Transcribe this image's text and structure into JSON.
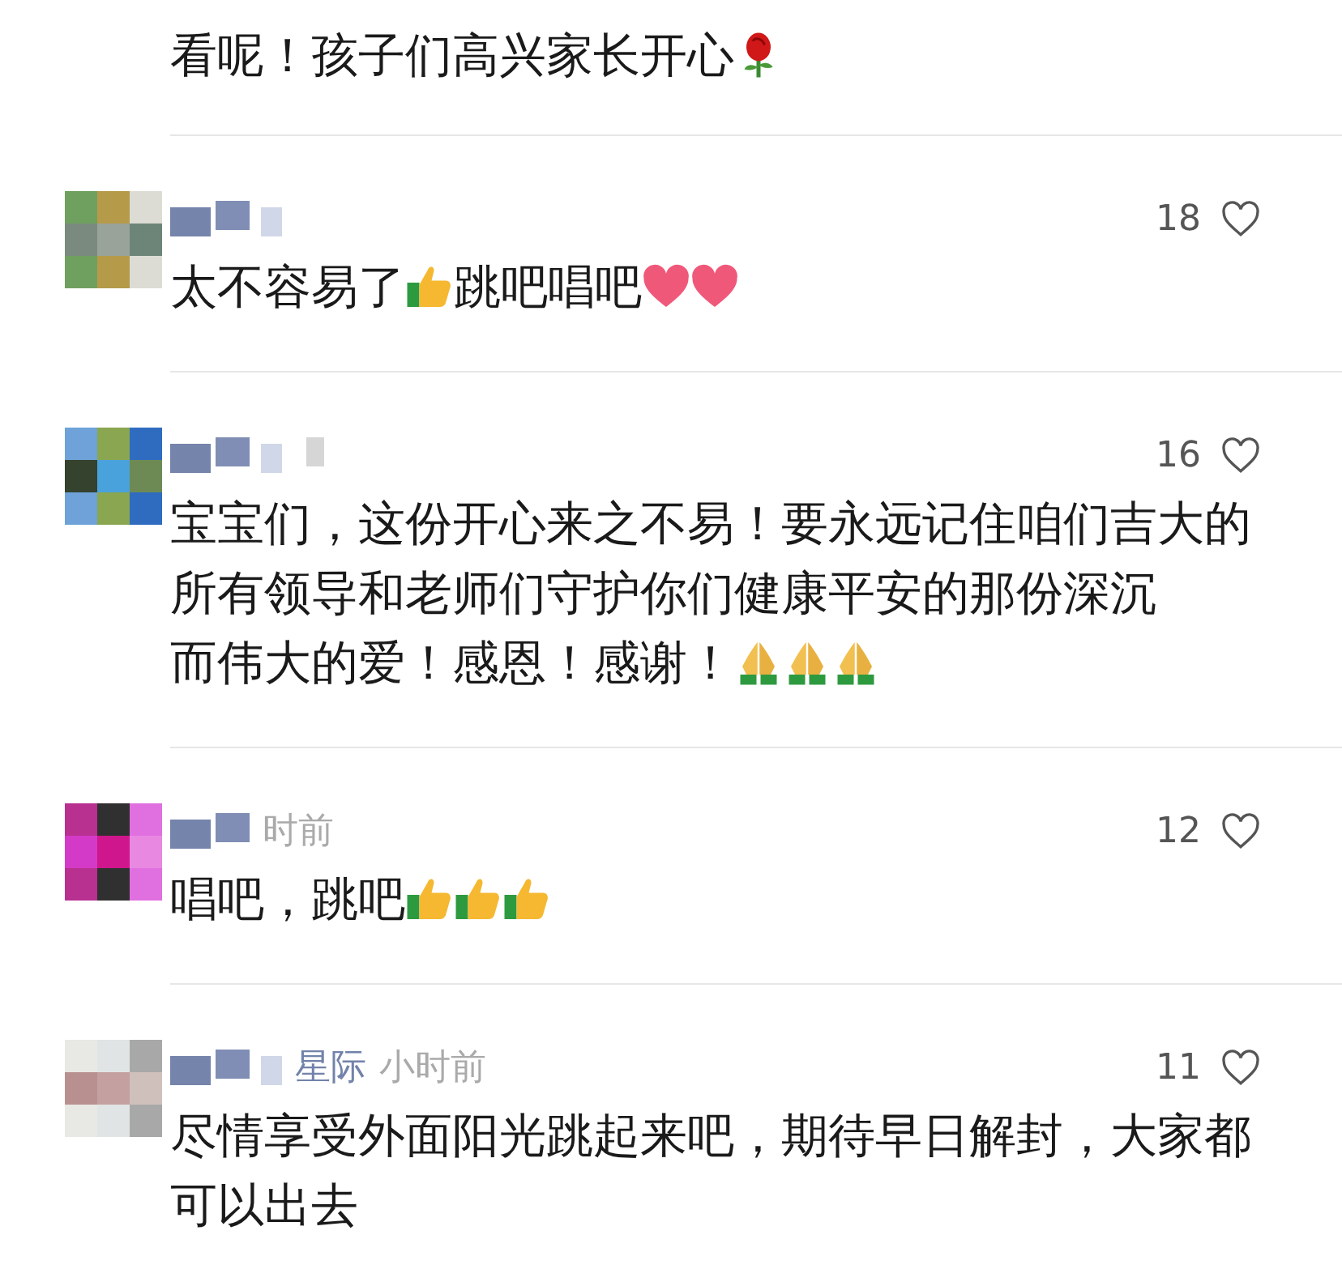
{
  "comments": [
    {
      "lines": [
        [
          {
            "kind": "text",
            "text": "看呢！孩子们高兴家长开心"
          },
          {
            "kind": "rose"
          }
        ]
      ]
    },
    {
      "likes": "18",
      "liked": false,
      "lines": [
        [
          {
            "kind": "text",
            "text": "太不容易了"
          },
          {
            "kind": "thumb"
          },
          {
            "kind": "text",
            "text": "跳吧唱吧"
          },
          {
            "kind": "heart"
          },
          {
            "kind": "heart"
          }
        ]
      ]
    },
    {
      "likes": "16",
      "liked": false,
      "lines": [
        [
          {
            "kind": "text",
            "text": "宝宝们，这份开心来之不易！要永远记住咱们吉大的所有领导和老师们守护你们健康平安的那份深沉"
          }
        ],
        [
          {
            "kind": "text",
            "text": "而伟大的爱！感恩！感谢！"
          },
          {
            "kind": "pray"
          },
          {
            "kind": "pray"
          },
          {
            "kind": "pray"
          }
        ]
      ]
    },
    {
      "time": "时前",
      "likes": "12",
      "liked": false,
      "lines": [
        [
          {
            "kind": "text",
            "text": "唱吧，跳吧"
          },
          {
            "kind": "thumb"
          },
          {
            "kind": "thumb"
          },
          {
            "kind": "thumb"
          }
        ]
      ]
    },
    {
      "name": "星际",
      "time": "小时前",
      "likes": "11",
      "liked": false,
      "lines": [
        [
          {
            "kind": "text",
            "text": "尽情享受外面阳光跳起来吧，期待早日解封，大家都可以出去"
          }
        ]
      ]
    }
  ]
}
